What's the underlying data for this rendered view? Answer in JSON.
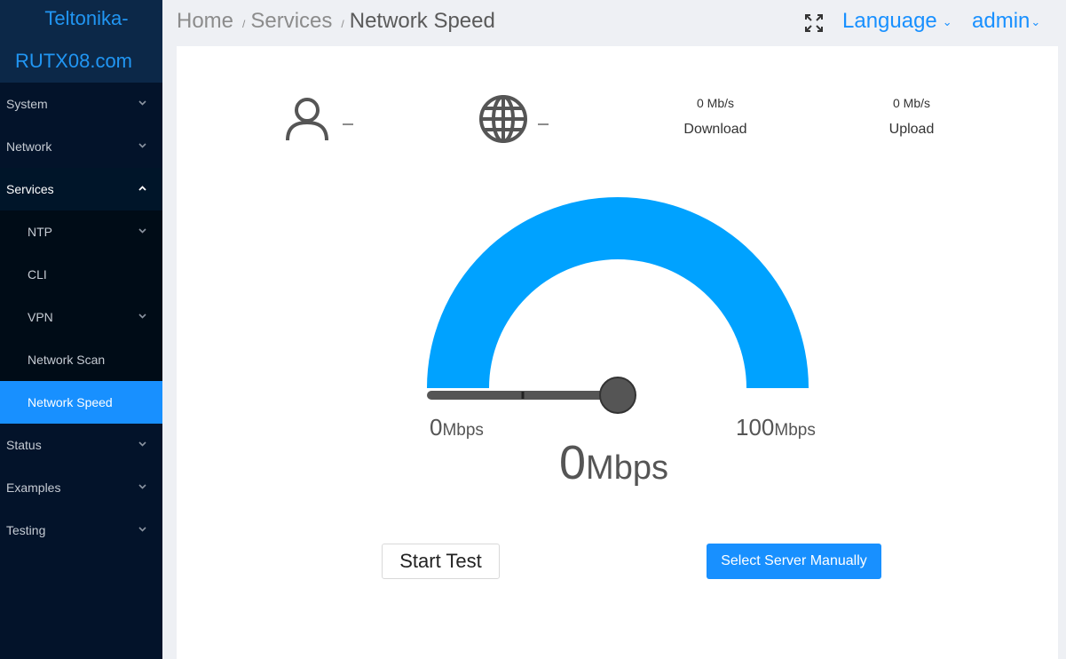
{
  "brand": {
    "line1": "Teltonika-",
    "line2": "RUTX08.com"
  },
  "sidebar": {
    "items": [
      {
        "label": "System"
      },
      {
        "label": "Network"
      },
      {
        "label": "Services"
      },
      {
        "label": "Status"
      },
      {
        "label": "Examples"
      },
      {
        "label": "Testing"
      }
    ],
    "services_sub": [
      {
        "label": "NTP"
      },
      {
        "label": "CLI"
      },
      {
        "label": "VPN"
      },
      {
        "label": "Network Scan"
      },
      {
        "label": "Network Speed"
      }
    ]
  },
  "breadcrumb": {
    "home": "Home",
    "sep": "/",
    "services": "Services",
    "current": "Network Speed"
  },
  "header": {
    "language": "Language",
    "user": "admin",
    "caret": "⌄"
  },
  "info": {
    "user_value": "–",
    "globe_value": "–",
    "download_value": "0 Mb/s",
    "download_label": "Download",
    "upload_value": "0 Mb/s",
    "upload_label": "Upload"
  },
  "gauge": {
    "min_value": "0",
    "max_value": "100",
    "unit": "Mbps",
    "current_value": "0",
    "current_fraction": 0,
    "arc_color": "#00a2ff",
    "needle_color": "#555555"
  },
  "buttons": {
    "start": "Start Test",
    "select": "Select Server Manually"
  },
  "colors": {
    "accent": "#1890ff",
    "sidebar_bg": "#03132a"
  }
}
